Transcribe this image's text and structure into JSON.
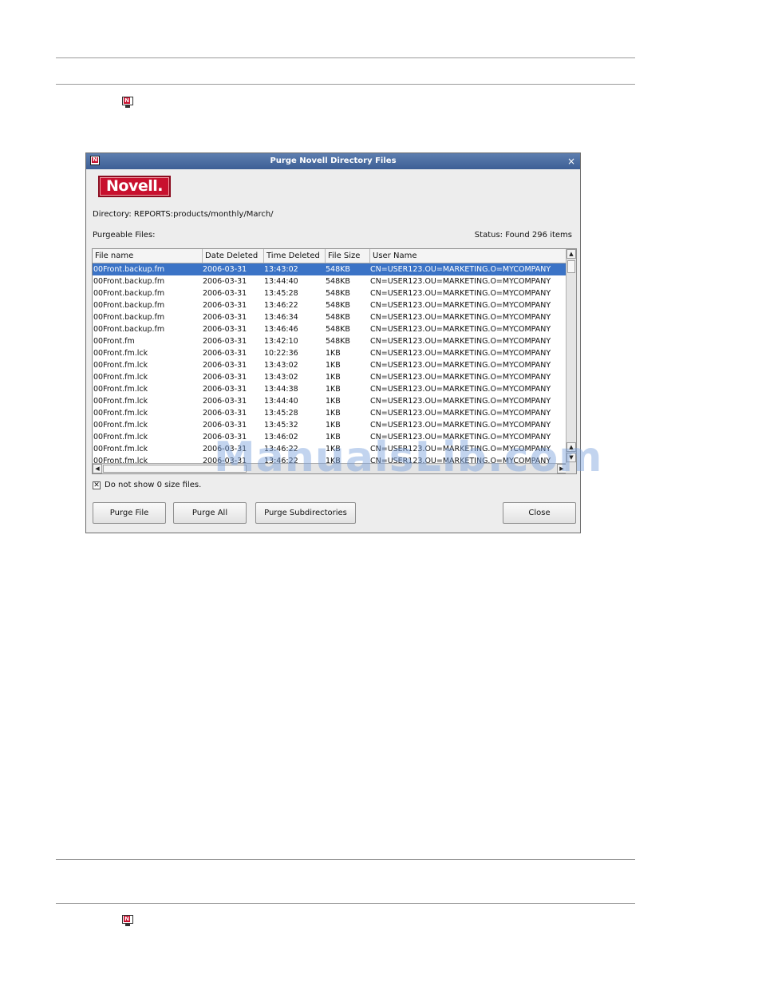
{
  "dialog": {
    "title": "Purge Novell Directory Files",
    "close_glyph": "×",
    "logo_text": "Novell.",
    "directory_label": "Directory:",
    "directory_value": "REPORTS:products/monthly/March/",
    "purgeable_label": "Purgeable Files:",
    "status_text": "Status: Found 296 items",
    "columns": [
      "File name",
      "Date Deleted",
      "Time Deleted",
      "File Size",
      "User Name"
    ],
    "rows": [
      [
        "00Front.backup.fm",
        "2006-03-31",
        "13:43:02",
        "548KB",
        "CN=USER123.OU=MARKETING.O=MYCOMPANY"
      ],
      [
        "00Front.backup.fm",
        "2006-03-31",
        "13:44:40",
        "548KB",
        "CN=USER123.OU=MARKETING.O=MYCOMPANY"
      ],
      [
        "00Front.backup.fm",
        "2006-03-31",
        "13:45:28",
        "548KB",
        "CN=USER123.OU=MARKETING.O=MYCOMPANY"
      ],
      [
        "00Front.backup.fm",
        "2006-03-31",
        "13:46:22",
        "548KB",
        "CN=USER123.OU=MARKETING.O=MYCOMPANY"
      ],
      [
        "00Front.backup.fm",
        "2006-03-31",
        "13:46:34",
        "548KB",
        "CN=USER123.OU=MARKETING.O=MYCOMPANY"
      ],
      [
        "00Front.backup.fm",
        "2006-03-31",
        "13:46:46",
        "548KB",
        "CN=USER123.OU=MARKETING.O=MYCOMPANY"
      ],
      [
        "00Front.fm",
        "2006-03-31",
        "13:42:10",
        "548KB",
        "CN=USER123.OU=MARKETING.O=MYCOMPANY"
      ],
      [
        "00Front.fm.lck",
        "2006-03-31",
        "10:22:36",
        "1KB",
        "CN=USER123.OU=MARKETING.O=MYCOMPANY"
      ],
      [
        "00Front.fm.lck",
        "2006-03-31",
        "13:43:02",
        "1KB",
        "CN=USER123.OU=MARKETING.O=MYCOMPANY"
      ],
      [
        "00Front.fm.lck",
        "2006-03-31",
        "13:43:02",
        "1KB",
        "CN=USER123.OU=MARKETING.O=MYCOMPANY"
      ],
      [
        "00Front.fm.lck",
        "2006-03-31",
        "13:44:38",
        "1KB",
        "CN=USER123.OU=MARKETING.O=MYCOMPANY"
      ],
      [
        "00Front.fm.lck",
        "2006-03-31",
        "13:44:40",
        "1KB",
        "CN=USER123.OU=MARKETING.O=MYCOMPANY"
      ],
      [
        "00Front.fm.lck",
        "2006-03-31",
        "13:45:28",
        "1KB",
        "CN=USER123.OU=MARKETING.O=MYCOMPANY"
      ],
      [
        "00Front.fm.lck",
        "2006-03-31",
        "13:45:32",
        "1KB",
        "CN=USER123.OU=MARKETING.O=MYCOMPANY"
      ],
      [
        "00Front.fm.lck",
        "2006-03-31",
        "13:46:02",
        "1KB",
        "CN=USER123.OU=MARKETING.O=MYCOMPANY"
      ],
      [
        "00Front.fm.lck",
        "2006-03-31",
        "13:46:22",
        "1KB",
        "CN=USER123.OU=MARKETING.O=MYCOMPANY"
      ],
      [
        "00Front.fm.lck",
        "2006-03-31",
        "13:46:22",
        "1KB",
        "CN=USER123.OU=MARKETING.O=MYCOMPANY"
      ]
    ],
    "selected_row": 0,
    "checkbox_label": "Do not show 0 size files.",
    "checkbox_checked": true,
    "buttons": {
      "purge_file": "Purge File",
      "purge_all": "Purge All",
      "purge_subdirectories": "Purge Subdirectories",
      "close": "Close"
    }
  },
  "icons": {
    "page_icon": "novell-monitor-icon",
    "scroll_up": "▲",
    "scroll_down": "▼",
    "scroll_left": "◀",
    "scroll_right": "▶"
  },
  "watermark_text": "ManualsLib.com",
  "colors": {
    "selection": "#3b73c6",
    "titlebar": "#3d5f95",
    "brand_red": "#c8102e"
  }
}
